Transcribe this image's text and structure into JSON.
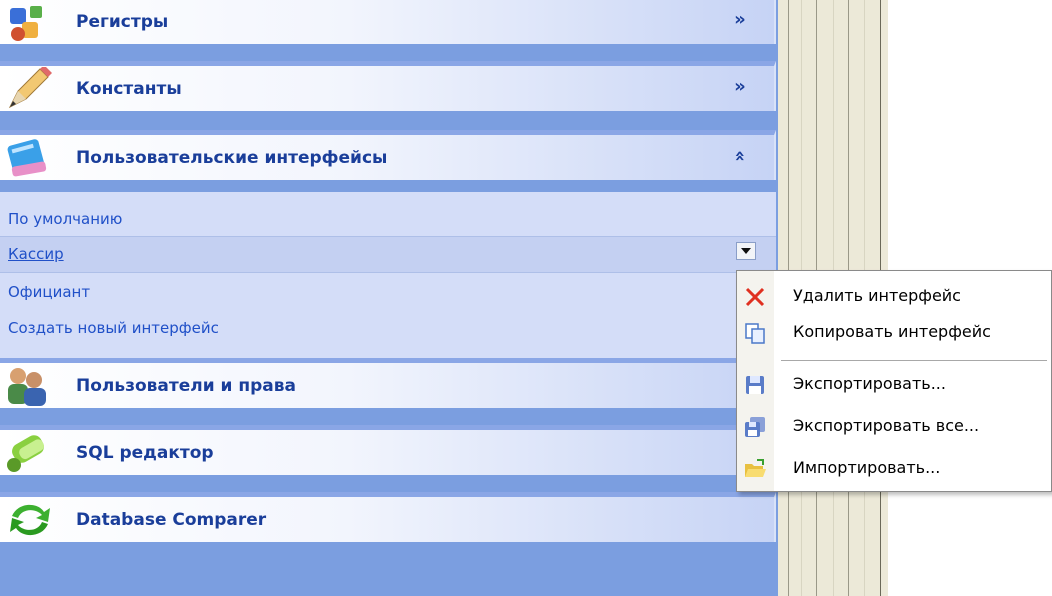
{
  "nav": {
    "groups": [
      {
        "title": "Регистры",
        "icon": "registers-icon",
        "state": "collapsed"
      },
      {
        "title": "Константы",
        "icon": "pencil-icon",
        "state": "collapsed"
      },
      {
        "title": "Пользовательские интерфейсы",
        "icon": "book-icon",
        "state": "expanded"
      },
      {
        "title": "Пользователи и права",
        "icon": "users-icon",
        "state": "collapsed"
      },
      {
        "title": "SQL редактор",
        "icon": "sql-icon",
        "state": "collapsed"
      },
      {
        "title": "Database Comparer",
        "icon": "compare-arrows-icon",
        "state": "collapsed"
      }
    ],
    "interfaces": [
      "По умолчанию",
      "Кассир",
      "Официант",
      "Создать новый интерфейс"
    ],
    "selected_interface": "Кассир"
  },
  "context_menu": {
    "items": [
      {
        "label": "Удалить интерфейс",
        "icon": "delete-x-icon"
      },
      {
        "label": "Копировать интерфейс",
        "icon": "copy-icon"
      },
      {
        "label": "Экспортировать...",
        "icon": "save-disk-icon"
      },
      {
        "label": "Экспортировать все...",
        "icon": "save-all-icon"
      },
      {
        "label": "Импортировать...",
        "icon": "open-folder-icon"
      }
    ]
  },
  "colors": {
    "pane_bg": "#7b9ee0",
    "header_text": "#1a3e9a",
    "item_text": "#2050c8",
    "delete_red": "#e03020"
  }
}
